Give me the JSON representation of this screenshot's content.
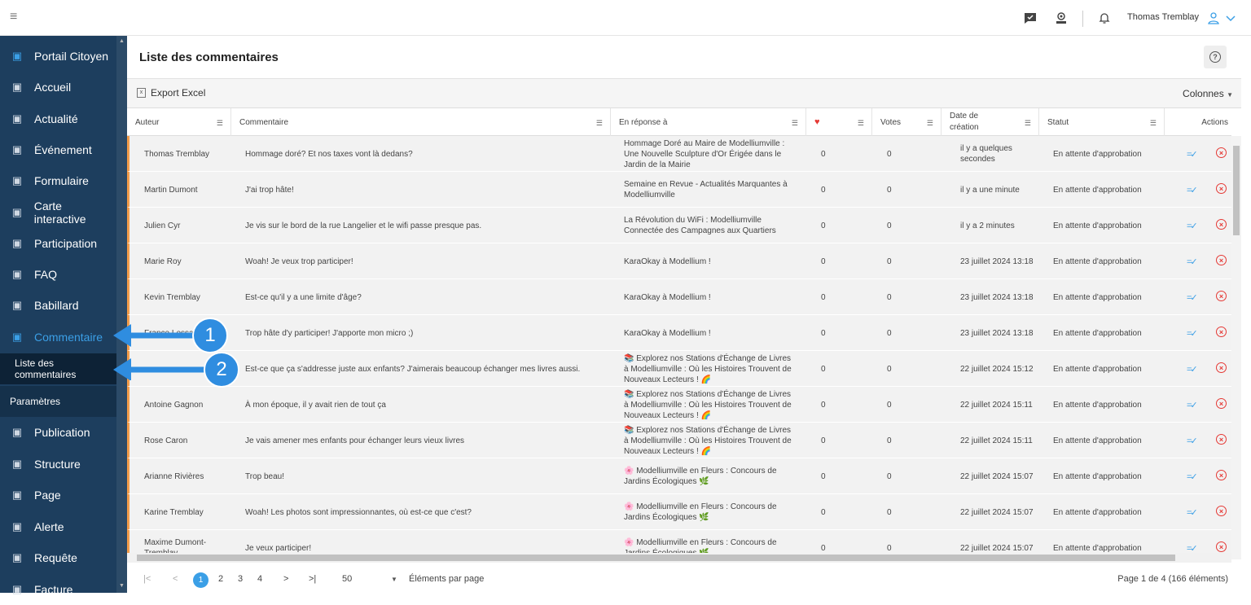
{
  "topbar": {
    "user_name": "Thomas Tremblay"
  },
  "sidebar": {
    "items": [
      {
        "label": "Portail Citoyen",
        "icon": "portal-icon"
      },
      {
        "label": "Accueil",
        "icon": "grid-icon"
      },
      {
        "label": "Actualité",
        "icon": "news-icon"
      },
      {
        "label": "Événement",
        "icon": "calendar-icon"
      },
      {
        "label": "Formulaire",
        "icon": "form-icon"
      },
      {
        "label": "Carte interactive",
        "icon": "map-icon"
      },
      {
        "label": "Participation",
        "icon": "bulb-icon"
      },
      {
        "label": "FAQ",
        "icon": "question-icon"
      },
      {
        "label": "Babillard",
        "icon": "board-icon"
      },
      {
        "label": "Commentaire",
        "icon": "comment-icon"
      }
    ],
    "sub_item": "Liste des commentaires",
    "section": "Paramètres",
    "items2": [
      {
        "label": "Publication",
        "icon": "publication-icon"
      },
      {
        "label": "Structure",
        "icon": "structure-icon"
      },
      {
        "label": "Page",
        "icon": "page-icon"
      },
      {
        "label": "Alerte",
        "icon": "alert-icon"
      },
      {
        "label": "Requête",
        "icon": "request-icon"
      },
      {
        "label": "Facture",
        "icon": "invoice-icon"
      }
    ]
  },
  "main": {
    "title": "Liste des commentaires",
    "export": "Export Excel",
    "columns_btn": "Colonnes"
  },
  "table": {
    "headers": [
      "Auteur",
      "Commentaire",
      "En réponse à",
      "",
      "Votes",
      "Date de création",
      "Statut",
      "Actions"
    ],
    "rows": [
      {
        "auteur": "Thomas Tremblay",
        "commentaire": "Hommage doré? Et nos taxes vont là dedans?",
        "reponse": "Hommage Doré au Maire de Modelliumville : Une Nouvelle Sculpture d'Or Érigée dans le Jardin de la Mairie",
        "likes": "0",
        "votes": "0",
        "date": "il y a quelques secondes",
        "statut": "En attente d'approbation"
      },
      {
        "auteur": "Martin Dumont",
        "commentaire": "J'ai trop hâte!",
        "reponse": "Semaine en Revue - Actualités Marquantes à Modelliumville",
        "likes": "0",
        "votes": "0",
        "date": "il y a une minute",
        "statut": "En attente d'approbation"
      },
      {
        "auteur": "Julien Cyr",
        "commentaire": "Je vis sur le bord de la rue Langelier et le wifi passe presque pas.",
        "reponse": "La Révolution du WiFi : Modelliumville Connectée des Campagnes aux Quartiers",
        "likes": "0",
        "votes": "0",
        "date": "il y a 2 minutes",
        "statut": "En attente d'approbation"
      },
      {
        "auteur": "Marie Roy",
        "commentaire": "Woah! Je veux trop participer!",
        "reponse": "KaraOkay à Modellium !",
        "likes": "0",
        "votes": "0",
        "date": "23 juillet 2024 13:18",
        "statut": "En attente d'approbation"
      },
      {
        "auteur": "Kevin Tremblay",
        "commentaire": "Est-ce qu'il y a une limite d'âge?",
        "reponse": "KaraOkay à Modellium !",
        "likes": "0",
        "votes": "0",
        "date": "23 juillet 2024 13:18",
        "statut": "En attente d'approbation"
      },
      {
        "auteur": "France Lessard",
        "commentaire": "Trop hâte d'y participer! J'apporte mon micro ;)",
        "reponse": "KaraOkay à Modellium !",
        "likes": "0",
        "votes": "0",
        "date": "23 juillet 2024 13:18",
        "statut": "En attente d'approbation"
      },
      {
        "auteur": "",
        "commentaire": "Est-ce que ça s'addresse juste aux enfants? J'aimerais beaucoup échanger mes livres aussi.",
        "reponse": "📚 Explorez nos Stations d'Échange de Livres à Modelliumville : Où les Histoires Trouvent de Nouveaux Lecteurs ! 🌈",
        "likes": "0",
        "votes": "0",
        "date": "22 juillet 2024 15:12",
        "statut": "En attente d'approbation"
      },
      {
        "auteur": "Antoine Gagnon",
        "commentaire": "À mon époque, il y avait rien de tout ça",
        "reponse": "📚 Explorez nos Stations d'Échange de Livres à Modelliumville : Où les Histoires Trouvent de Nouveaux Lecteurs ! 🌈",
        "likes": "0",
        "votes": "0",
        "date": "22 juillet 2024 15:11",
        "statut": "En attente d'approbation"
      },
      {
        "auteur": "Rose Caron",
        "commentaire": "Je vais amener mes enfants pour échanger leurs vieux livres",
        "reponse": "📚 Explorez nos Stations d'Échange de Livres à Modelliumville : Où les Histoires Trouvent de Nouveaux Lecteurs ! 🌈",
        "likes": "0",
        "votes": "0",
        "date": "22 juillet 2024 15:11",
        "statut": "En attente d'approbation"
      },
      {
        "auteur": "Arianne Rivières",
        "commentaire": "Trop beau!",
        "reponse": "🌸 Modelliumville en Fleurs : Concours de Jardins Écologiques 🌿",
        "likes": "0",
        "votes": "0",
        "date": "22 juillet 2024 15:07",
        "statut": "En attente d'approbation"
      },
      {
        "auteur": "Karine Tremblay",
        "commentaire": "Woah! Les photos sont impressionnantes, où est-ce que c'est?",
        "reponse": "🌸 Modelliumville en Fleurs : Concours de Jardins Écologiques 🌿",
        "likes": "0",
        "votes": "0",
        "date": "22 juillet 2024 15:07",
        "statut": "En attente d'approbation"
      },
      {
        "auteur": "Maxime Dumont-Tremblay",
        "commentaire": "Je veux participer!",
        "reponse": "🌸 Modelliumville en Fleurs : Concours de Jardins Écologiques 🌿",
        "likes": "0",
        "votes": "0",
        "date": "22 juillet 2024 15:07",
        "statut": "En attente d'approbation"
      }
    ]
  },
  "pager": {
    "pages": [
      "1",
      "2",
      "3",
      "4"
    ],
    "page_size": "50",
    "page_size_label": "Éléments par page",
    "info": "Page 1 de 4 (166 éléments)"
  },
  "callouts": [
    "1",
    "2"
  ],
  "colors": {
    "accent": "#3b9fe6",
    "sidebar": "#1d3e5e",
    "row_bar": "#f39c4a",
    "delete": "#e53935"
  }
}
